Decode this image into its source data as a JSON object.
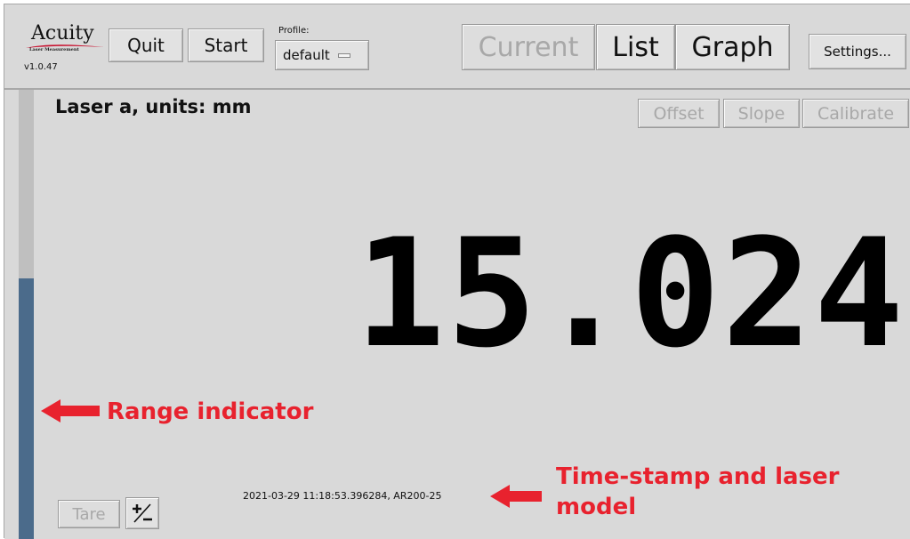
{
  "app": {
    "logo_text": "Acuity",
    "logo_subtext": "Laser Measurement",
    "version": "v1.0.47"
  },
  "toolbar": {
    "quit_label": "Quit",
    "start_label": "Start",
    "profile_label": "Profile:",
    "profile_value": "default",
    "current_label": "Current",
    "list_label": "List",
    "graph_label": "Graph",
    "settings_label": "Settings..."
  },
  "panel": {
    "title": "Laser a, units: mm",
    "offset_label": "Offset",
    "slope_label": "Slope",
    "calibrate_label": "Calibrate",
    "reading": "15.024",
    "timestamp": "2021-03-29 11:18:53.396284, AR200-25",
    "tare_label": "Tare",
    "sign_label": "+/-",
    "range_fraction": 0.58
  },
  "annotations": {
    "range_indicator": "Range indicator",
    "timestamp_note": "Time-stamp and laser model"
  },
  "colors": {
    "background": "#d9d9d9",
    "range_fill": "#4b6b8b",
    "annotation": "#e8222e",
    "logo_swoosh": "#c8102e"
  },
  "icons": {
    "plus_minus": "plus-minus-icon",
    "annotation_arrow": "left-arrow-icon"
  }
}
